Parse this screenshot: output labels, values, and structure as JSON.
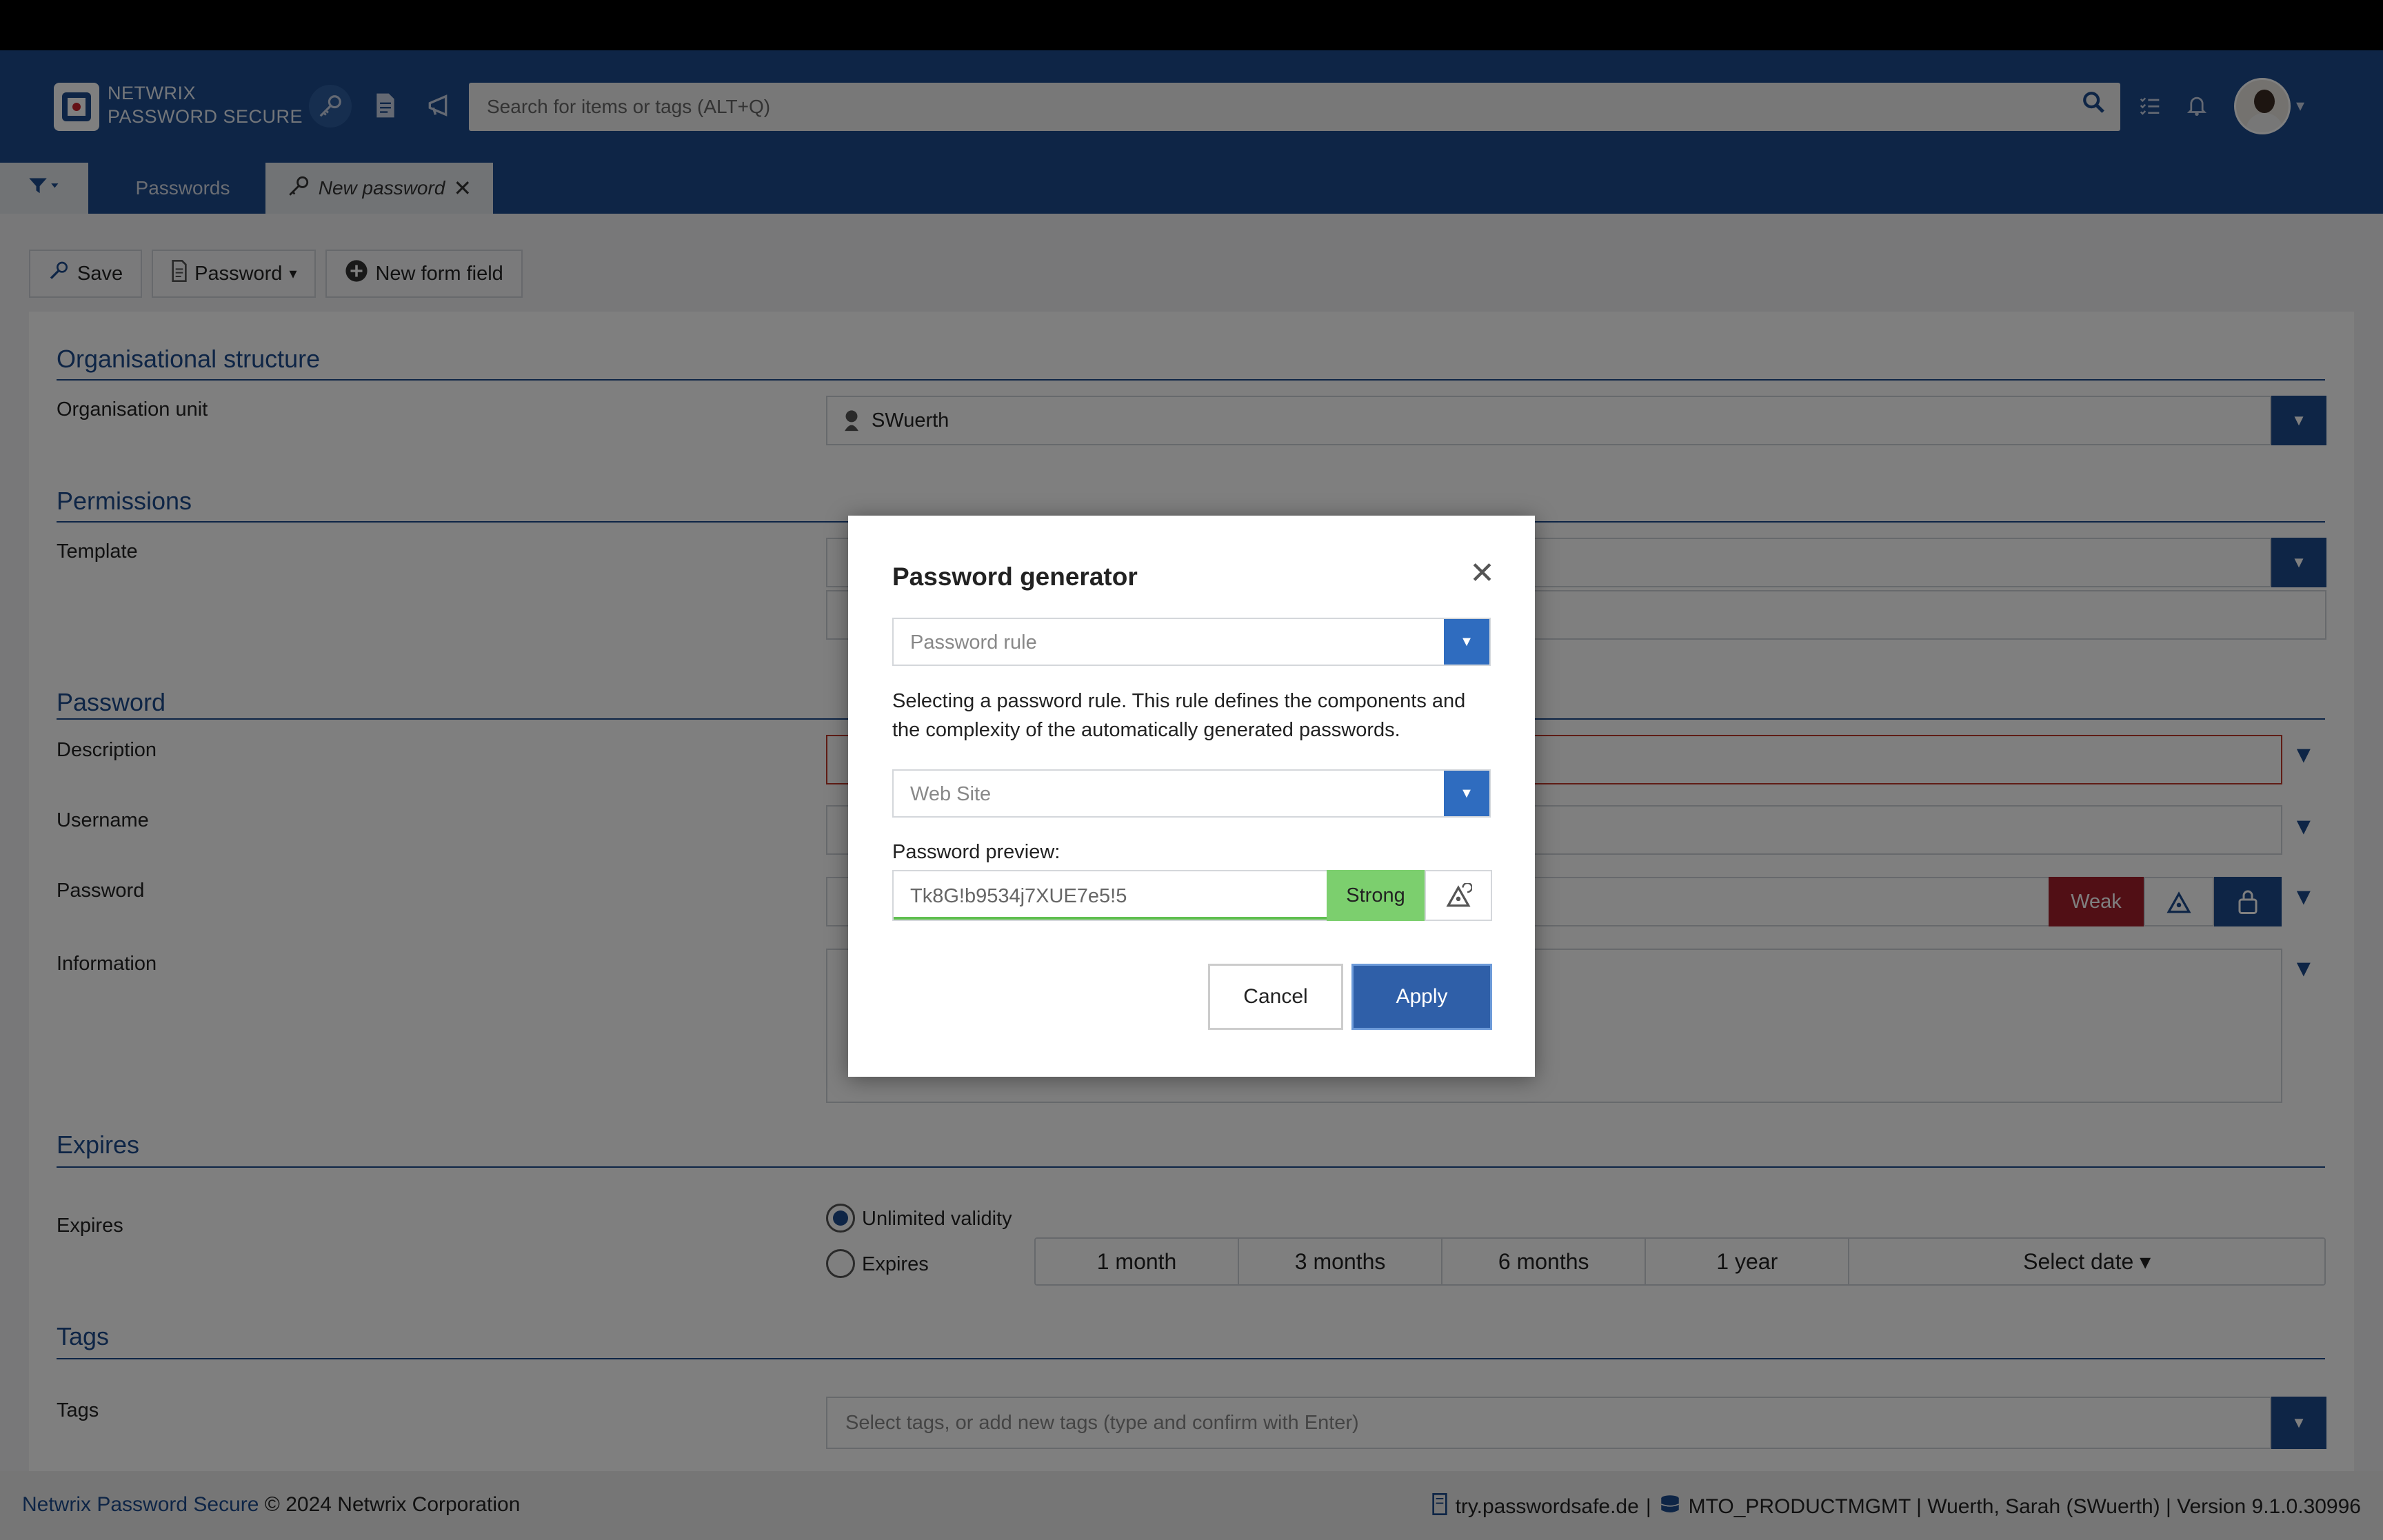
{
  "app": {
    "brand_line1": "NETWRIX",
    "brand_line2": "PASSWORD SECURE"
  },
  "header": {
    "search_placeholder": "Search for items or tags (ALT+Q)",
    "icons": [
      "key-icon",
      "document-icon",
      "megaphone-icon",
      "search-icon",
      "checklist-icon",
      "bell-icon",
      "avatar"
    ]
  },
  "tabs": [
    {
      "label": "Passwords"
    },
    {
      "label": "New password"
    }
  ],
  "toolbar": {
    "save_label": "Save",
    "password_label": "Password",
    "new_field_label": "New form field"
  },
  "form": {
    "org_section": "Organisational structure",
    "org_unit_label": "Organisation unit",
    "org_unit_value": "SWuerth",
    "permissions_section": "Permissions",
    "template_label": "Template",
    "password_section": "Password",
    "description_label": "Description",
    "username_label": "Username",
    "password_label": "Password",
    "password_strength": "Weak",
    "information_label": "Information",
    "expires_section": "Expires",
    "expires_label": "Expires",
    "unlimited_label": "Unlimited validity",
    "expires_option": "Expires",
    "durations": [
      "1 month",
      "3 months",
      "6 months",
      "1 year",
      "Select date ▾"
    ],
    "tags_section": "Tags",
    "tags_label": "Tags",
    "tags_placeholder": "Select tags, or add new tags (type and confirm with Enter)"
  },
  "modal": {
    "title": "Password generator",
    "rule_placeholder": "Password rule",
    "description": "Selecting a password rule. This rule defines the components and the complexity of the automatically generated passwords.",
    "type_placeholder": "Web Site",
    "preview_label": "Password preview:",
    "preview_value": "Tk8G!b9534j7XUE7e5!5",
    "strength": "Strong",
    "cancel_label": "Cancel",
    "apply_label": "Apply"
  },
  "footer": {
    "product_link": "Netwrix Password Secure",
    "copyright": "© 2024 Netwrix Corporation",
    "server": "try.passwordsafe.de",
    "status": "MTO_PRODUCTMGMT | Wuerth, Sarah (SWuerth) | Version 9.1.0.30996"
  },
  "colors": {
    "primary": "#1d4b8c",
    "weak": "#a31e2a",
    "strong": "#7ccf6e",
    "apply": "#2f5fa8"
  }
}
